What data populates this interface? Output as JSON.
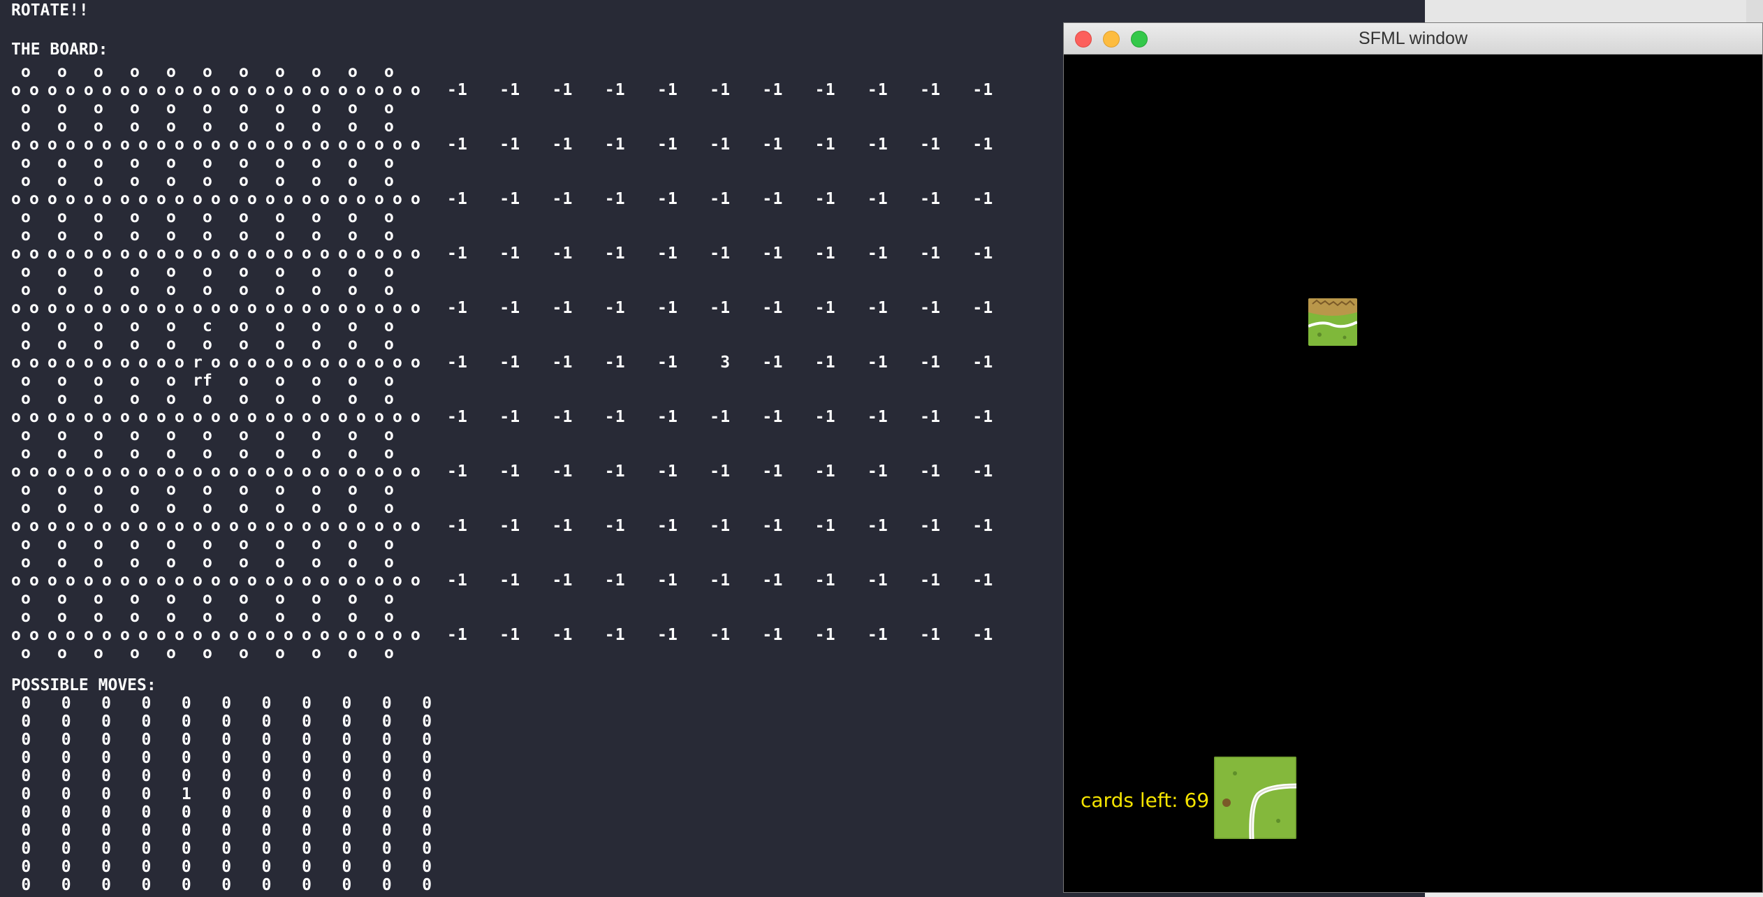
{
  "terminal": {
    "rotate_line": "ROTATE!!",
    "board_title": "THE BOARD:",
    "moves_title": "POSSIBLE MOVES:",
    "board_value_rows": [
      "-1   -1   -1   -1   -1   -1   -1   -1   -1   -1   -1",
      "-1   -1   -1   -1   -1   -1   -1   -1   -1   -1   -1",
      "-1   -1   -1   -1   -1   -1   -1   -1   -1   -1   -1",
      "-1   -1   -1   -1   -1   -1   -1   -1   -1   -1   -1",
      "-1   -1   -1   -1   -1   -1   -1   -1   -1   -1   -1",
      "-1   -1   -1   -1   -1    3   -1   -1   -1   -1   -1",
      "-1   -1   -1   -1   -1   -1   -1   -1   -1   -1   -1",
      "-1   -1   -1   -1   -1   -1   -1   -1   -1   -1   -1",
      "-1   -1   -1   -1   -1   -1   -1   -1   -1   -1   -1",
      "-1   -1   -1   -1   -1   -1   -1   -1   -1   -1   -1",
      "-1   -1   -1   -1   -1   -1   -1   -1   -1   -1   -1"
    ],
    "possible_moves_rows": [
      " 0   0   0   0   0   0   0   0   0   0   0",
      " 0   0   0   0   0   0   0   0   0   0   0",
      " 0   0   0   0   0   0   0   0   0   0   0",
      " 0   0   0   0   0   0   0   0   0   0   0",
      " 0   0   0   0   0   0   0   0   0   0   0",
      " 0   0   0   0   1   0   0   0   0   0   0",
      " 0   0   0   0   0   0   0   0   0   0   0",
      " 0   0   0   0   0   0   0   0   0   0   0",
      " 0   0   0   0   0   0   0   0   0   0   0",
      " 0   0   0   0   0   0   0   0   0   0   0",
      " 0   0   0   0   0   0   0   0   0   0   0"
    ],
    "board_marks": {
      "top_c": "c",
      "middle_rr": "r r",
      "bottom_f": "f"
    }
  },
  "sfml_window": {
    "title": "SFML window",
    "cards_left": "cards left: 69",
    "colors": {
      "background": "#000000",
      "cards_left_text": "#f5e400"
    }
  }
}
